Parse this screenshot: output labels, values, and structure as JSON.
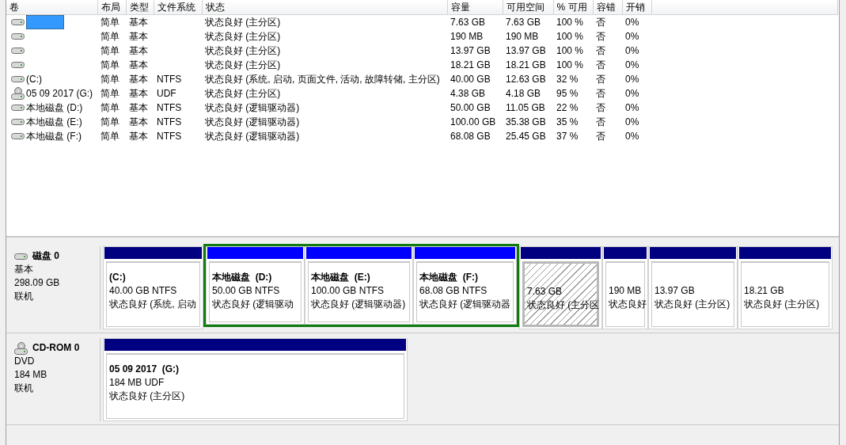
{
  "volume_list": {
    "columns": [
      "卷",
      "布局",
      "类型",
      "文件系统",
      "状态",
      "容量",
      "可用空间",
      "% 可用",
      "容错",
      "开销"
    ],
    "rows": [
      {
        "kind": "disk",
        "selected": true,
        "layout": "简单",
        "type": "基本",
        "status": "状态良好 (主分区)",
        "capacity": "7.63 GB",
        "free": "7.63 GB",
        "percent_free": "100 %",
        "fault_tolerance": "否",
        "overhead": "0%"
      },
      {
        "kind": "disk",
        "selected": false,
        "layout": "简单",
        "type": "基本",
        "status": "状态良好 (主分区)",
        "capacity": "190 MB",
        "free": "190 MB",
        "percent_free": "100 %",
        "fault_tolerance": "否",
        "overhead": "0%"
      },
      {
        "kind": "disk",
        "selected": false,
        "layout": "简单",
        "type": "基本",
        "status": "状态良好 (主分区)",
        "capacity": "13.97 GB",
        "free": "13.97 GB",
        "percent_free": "100 %",
        "fault_tolerance": "否",
        "overhead": "0%"
      },
      {
        "kind": "disk",
        "selected": false,
        "layout": "简单",
        "type": "基本",
        "status": "状态良好 (主分区)",
        "capacity": "18.21 GB",
        "free": "18.21 GB",
        "percent_free": "100 %",
        "fault_tolerance": "否",
        "overhead": "0%"
      },
      {
        "kind": "disk",
        "selected": false,
        "volume": "(C:)",
        "layout": "简单",
        "type": "基本",
        "filesystem": "NTFS",
        "status": "状态良好 (系统, 启动, 页面文件, 活动, 故障转储, 主分区)",
        "capacity": "40.00 GB",
        "free": "12.63 GB",
        "percent_free": "32 %",
        "fault_tolerance": "否",
        "overhead": "0%"
      },
      {
        "kind": "cdrom",
        "selected": false,
        "volume": "05 09 2017 (G:)",
        "layout": "简单",
        "type": "基本",
        "filesystem": "UDF",
        "status": "状态良好 (主分区)",
        "capacity": "4.38 GB",
        "free": "4.18 GB",
        "percent_free": "95 %",
        "fault_tolerance": "否",
        "overhead": "0%"
      },
      {
        "kind": "disk",
        "selected": false,
        "volume": "本地磁盘 (D:)",
        "layout": "简单",
        "type": "基本",
        "filesystem": "NTFS",
        "status": "状态良好 (逻辑驱动器)",
        "capacity": "50.00 GB",
        "free": "11.05 GB",
        "percent_free": "22 %",
        "fault_tolerance": "否",
        "overhead": "0%"
      },
      {
        "kind": "disk",
        "selected": false,
        "volume": "本地磁盘 (E:)",
        "layout": "简单",
        "type": "基本",
        "filesystem": "NTFS",
        "status": "状态良好 (逻辑驱动器)",
        "capacity": "100.00 GB",
        "free": "35.38 GB",
        "percent_free": "35 %",
        "fault_tolerance": "否",
        "overhead": "0%"
      },
      {
        "kind": "disk",
        "selected": false,
        "volume": "本地磁盘 (F:)",
        "layout": "简单",
        "type": "基本",
        "filesystem": "NTFS",
        "status": "状态良好 (逻辑驱动器)",
        "capacity": "68.08 GB",
        "free": "25.45 GB",
        "percent_free": "37 %",
        "fault_tolerance": "否",
        "overhead": "0%"
      }
    ]
  },
  "disks": [
    {
      "kind": "disk",
      "name": "磁盘 0",
      "type": "基本",
      "size": "298.09 GB",
      "status": "联机",
      "partitions": [
        {
          "kind": "primary",
          "selected": false,
          "name": "(C:)",
          "size": "40.00 GB NTFS",
          "status": "状态良好 (系统, 启动"
        },
        {
          "kind": "extended",
          "children": [
            {
              "kind": "logical",
              "selected": false,
              "name": "本地磁盘  (D:)",
              "size": "50.00 GB NTFS",
              "status": "状态良好 (逻辑驱动"
            },
            {
              "kind": "logical",
              "selected": false,
              "name": "本地磁盘  (E:)",
              "size": "100.00 GB NTFS",
              "status": "状态良好 (逻辑驱动器)"
            },
            {
              "kind": "logical",
              "selected": false,
              "name": "本地磁盘  (F:)",
              "size": "68.08 GB NTFS",
              "status": "状态良好 (逻辑驱动器"
            }
          ]
        },
        {
          "kind": "primary",
          "selected": true,
          "size": "7.63 GB",
          "status": "状态良好 (主分区"
        },
        {
          "kind": "primary",
          "selected": false,
          "size": "190 MB",
          "status": "状态良好"
        },
        {
          "kind": "primary",
          "selected": false,
          "size": "13.97 GB",
          "status": "状态良好 (主分区)"
        },
        {
          "kind": "primary",
          "selected": false,
          "size": "18.21 GB",
          "status": "状态良好 (主分区)"
        }
      ]
    },
    {
      "kind": "cdrom",
      "name": "CD-ROM 0",
      "type": "DVD",
      "size": "184 MB",
      "status": "联机",
      "partitions": [
        {
          "kind": "primary",
          "selected": false,
          "name": "05 09 2017  (G:)",
          "size": "184 MB UDF",
          "status": "状态良好 (主分区)"
        }
      ]
    }
  ]
}
